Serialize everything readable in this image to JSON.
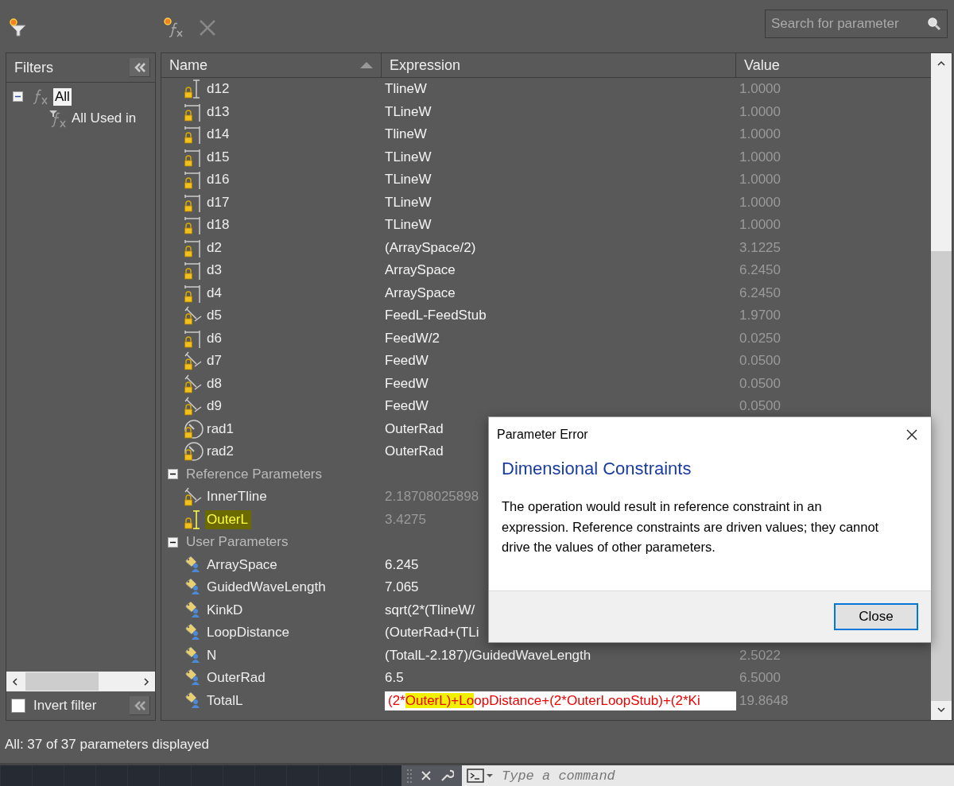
{
  "search": {
    "placeholder": "Search for parameter"
  },
  "filters": {
    "title": "Filters",
    "tree": [
      {
        "label": "All",
        "selected": true,
        "expanded": true,
        "children": [
          {
            "label": "All Used in",
            "selected": false
          }
        ]
      }
    ],
    "invert_filter": {
      "label": "Invert filter",
      "checked": false
    }
  },
  "table": {
    "columns": [
      {
        "label": "Name",
        "sorted": true
      },
      {
        "label": "Expression",
        "sorted": false
      },
      {
        "label": "Value",
        "sorted": false
      }
    ],
    "rows": [
      {
        "kind": "vertical",
        "name": "d12",
        "expression": "TlineW",
        "value": "1.0000",
        "driven": false,
        "highlighted": false
      },
      {
        "kind": "horizontal",
        "name": "d13",
        "expression": "TLineW",
        "value": "1.0000",
        "driven": false,
        "highlighted": false
      },
      {
        "kind": "horizontal",
        "name": "d14",
        "expression": "TlineW",
        "value": "1.0000",
        "driven": false,
        "highlighted": false
      },
      {
        "kind": "horizontal",
        "name": "d15",
        "expression": "TLineW",
        "value": "1.0000",
        "driven": false,
        "highlighted": false
      },
      {
        "kind": "horizontal",
        "name": "d16",
        "expression": "TLineW",
        "value": "1.0000",
        "driven": false,
        "highlighted": false
      },
      {
        "kind": "horizontal",
        "name": "d17",
        "expression": "TLineW",
        "value": "1.0000",
        "driven": false,
        "highlighted": false
      },
      {
        "kind": "horizontal",
        "name": "d18",
        "expression": "TLineW",
        "value": "1.0000",
        "driven": false,
        "highlighted": false
      },
      {
        "kind": "horizontal",
        "name": "d2",
        "expression": "(ArraySpace/2)",
        "value": "3.1225",
        "driven": false,
        "highlighted": false
      },
      {
        "kind": "horizontal",
        "name": "d3",
        "expression": "ArraySpace",
        "value": "6.2450",
        "driven": false,
        "highlighted": false
      },
      {
        "kind": "horizontal",
        "name": "d4",
        "expression": "ArraySpace",
        "value": "6.2450",
        "driven": false,
        "highlighted": false
      },
      {
        "kind": "aligned",
        "name": "d5",
        "expression": "FeedL-FeedStub",
        "value": "1.9700",
        "driven": false,
        "highlighted": false
      },
      {
        "kind": "horizontal",
        "name": "d6",
        "expression": "FeedW/2",
        "value": "0.0250",
        "driven": false,
        "highlighted": false
      },
      {
        "kind": "aligned",
        "name": "d7",
        "expression": "FeedW",
        "value": "0.0500",
        "driven": false,
        "highlighted": false
      },
      {
        "kind": "aligned",
        "name": "d8",
        "expression": "FeedW",
        "value": "0.0500",
        "driven": false,
        "highlighted": false
      },
      {
        "kind": "aligned",
        "name": "d9",
        "expression": "FeedW",
        "value": "0.0500",
        "driven": false,
        "highlighted": false
      },
      {
        "kind": "radial",
        "name": "rad1",
        "expression": "OuterRad",
        "driven": false,
        "highlighted": false
      },
      {
        "kind": "radial",
        "name": "rad2",
        "expression": "OuterRad",
        "driven": false,
        "highlighted": false
      },
      {
        "kind": "group",
        "label": "Reference Parameters",
        "expanded": true
      },
      {
        "kind": "aligned",
        "name": "InnerTline",
        "expression": "2.18708025898",
        "driven": true,
        "highlighted": false
      },
      {
        "kind": "vertical",
        "name": "OuterL",
        "expression": "3.4275",
        "driven": true,
        "highlighted": true
      },
      {
        "kind": "group",
        "label": "User Parameters",
        "expanded": true
      },
      {
        "kind": "user",
        "name": "ArraySpace",
        "expression": "6.245",
        "driven": false,
        "highlighted": false
      },
      {
        "kind": "user",
        "name": "GuidedWaveLength",
        "expression": "7.065",
        "driven": false,
        "highlighted": false
      },
      {
        "kind": "user",
        "name": "KinkD",
        "expression": "sqrt(2*(TlineW/",
        "driven": false,
        "highlighted": false
      },
      {
        "kind": "user",
        "name": "LoopDistance",
        "expression": "(OuterRad+(TLi",
        "driven": false,
        "highlighted": false
      },
      {
        "kind": "user",
        "name": "N",
        "expression": "(TotalL-2.187)/GuidedWaveLength",
        "value": "2.5022",
        "driven": false,
        "highlighted": false
      },
      {
        "kind": "user",
        "name": "OuterRad",
        "expression": "6.5",
        "value": "6.5000",
        "driven": false,
        "highlighted": false
      },
      {
        "kind": "user",
        "name": "TotalL",
        "editing": true,
        "expression_parts": [
          {
            "text": "(2*",
            "highlighted": false
          },
          {
            "text": "OuterL)+Lo",
            "highlighted": true
          },
          {
            "text": "opDistance+(2*OuterLoopStub)+(2*Ki",
            "highlighted": false
          }
        ],
        "value": "19.8648",
        "highlighted": false
      }
    ]
  },
  "status": "All: 37 of 37 parameters displayed",
  "dialog": {
    "title": "Parameter Error",
    "heading": "Dimensional Constraints",
    "message": "The operation would result in reference constraint in an expression. Reference constraints are driven values; they cannot drive the values of other parameters.",
    "buttons": [
      {
        "label": "Close",
        "default": true
      }
    ]
  },
  "command_line": {
    "placeholder": "Type a command"
  }
}
